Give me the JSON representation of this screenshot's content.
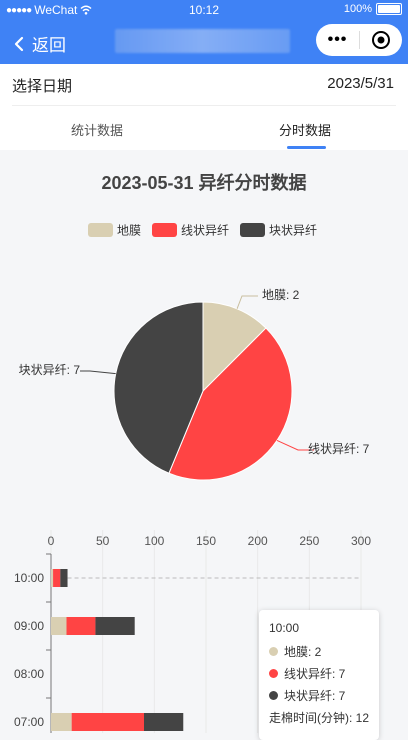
{
  "status_bar": {
    "carrier": "WeChat",
    "time": "10:12",
    "battery": "100%"
  },
  "nav": {
    "back_label": "返回"
  },
  "date_row": {
    "label": "选择日期",
    "value": "2023/5/31"
  },
  "tabs": [
    {
      "label": "统计数据"
    },
    {
      "label": "分时数据"
    }
  ],
  "colors": {
    "accent": "#3f82f5",
    "s1": "#d9cfb2",
    "s2": "#ff4444",
    "s3": "#444444"
  },
  "chart_data": [
    {
      "type": "pie",
      "title": "2023-05-31 异纤分时数据",
      "legend": [
        "地膜",
        "线状异纤",
        "块状异纤"
      ],
      "legend_position": "top-center",
      "slices": [
        {
          "name": "地膜",
          "value": 2,
          "label": "地膜: 2"
        },
        {
          "name": "线状异纤",
          "value": 7,
          "label": "线状异纤: 7"
        },
        {
          "name": "块状异纤",
          "value": 7,
          "label": "块状异纤: 7"
        }
      ]
    },
    {
      "type": "bar",
      "orientation": "horizontal",
      "stacked": true,
      "x_ticks": [
        "0",
        "50",
        "100",
        "150",
        "200",
        "250",
        "300"
      ],
      "xlim": [
        0,
        300
      ],
      "categories": [
        "10:00",
        "09:00",
        "08:00",
        "07:00"
      ],
      "series": [
        {
          "name": "地膜",
          "values": [
            2,
            15,
            0,
            20
          ]
        },
        {
          "name": "线状异纤",
          "values": [
            7,
            28,
            0,
            70
          ]
        },
        {
          "name": "块状异纤",
          "values": [
            7,
            38,
            0,
            38
          ]
        }
      ]
    }
  ],
  "tooltip": {
    "time": "10:00",
    "rows": [
      "地膜: 2",
      "线状异纤: 7",
      "块状异纤: 7"
    ],
    "footer": "走棉时间(分钟): 12"
  }
}
